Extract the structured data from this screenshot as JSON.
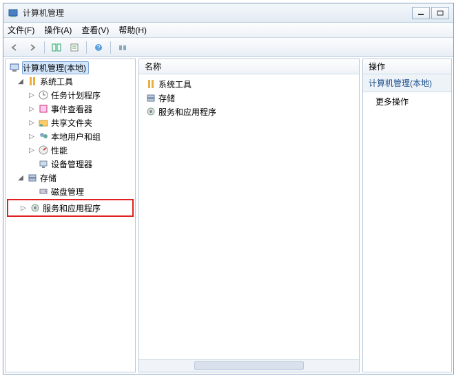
{
  "window": {
    "title": "计算机管理"
  },
  "menubar": {
    "file": "文件(F)",
    "action": "操作(A)",
    "view": "查看(V)",
    "help": "帮助(H)"
  },
  "tree": {
    "root": "计算机管理(本地)",
    "system_tools": "系统工具",
    "task_scheduler": "任务计划程序",
    "event_viewer": "事件查看器",
    "shared_folders": "共享文件夹",
    "local_users": "本地用户和组",
    "performance": "性能",
    "device_manager": "设备管理器",
    "storage": "存储",
    "disk_mgmt": "磁盘管理",
    "services_apps": "服务和应用程序"
  },
  "center": {
    "column": "名称",
    "items": {
      "system_tools": "系统工具",
      "storage": "存储",
      "services_apps": "服务和应用程序"
    }
  },
  "actions": {
    "title": "操作",
    "context": "计算机管理(本地)",
    "more": "更多操作"
  }
}
